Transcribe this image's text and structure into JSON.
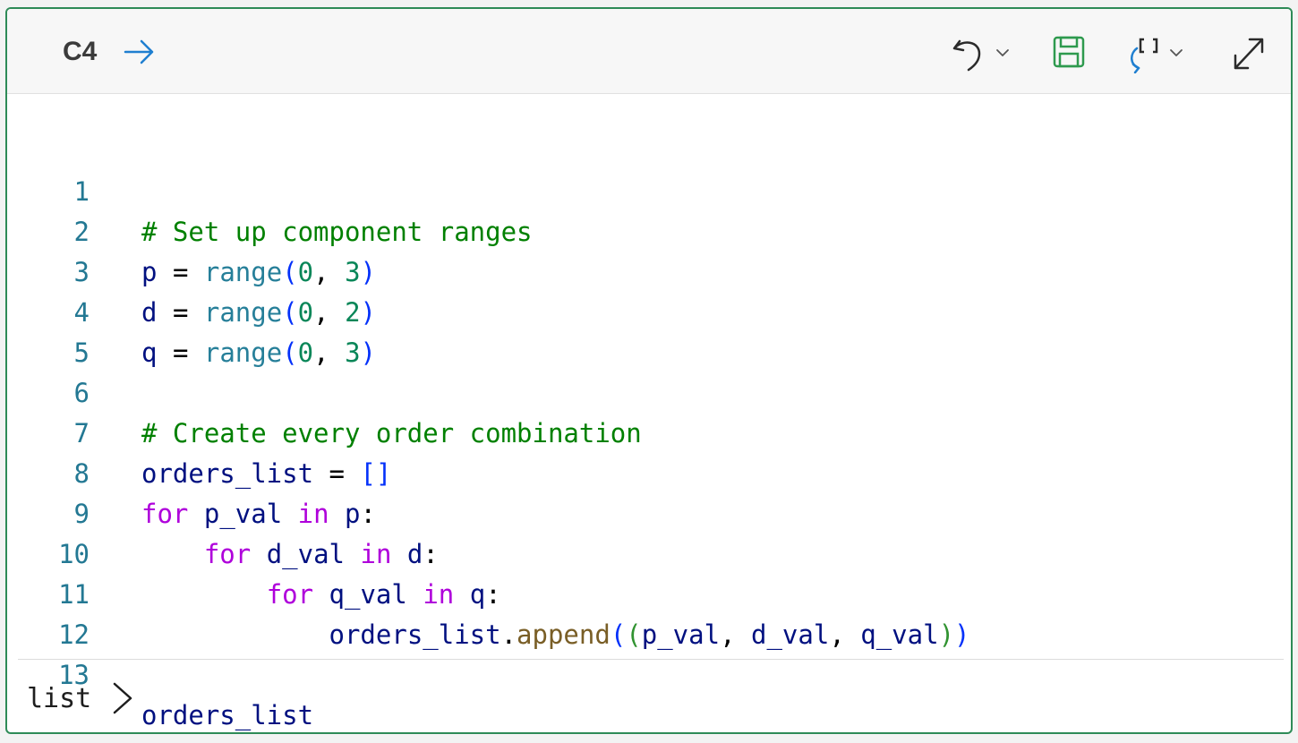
{
  "header": {
    "cell_ref": "C4",
    "arrow_icon": "arrow-right-icon",
    "toolbar": [
      {
        "name": "undo",
        "icon": "undo-icon"
      },
      {
        "name": "save",
        "icon": "save-icon"
      },
      {
        "name": "return-type",
        "icon": "return-list-icon"
      },
      {
        "name": "expand",
        "icon": "expand-icon"
      }
    ]
  },
  "code_lines": [
    {
      "n": "1",
      "text": "# Set up component ranges"
    },
    {
      "n": "2",
      "text": "p = range(0, 3)"
    },
    {
      "n": "3",
      "text": "d = range(0, 2)"
    },
    {
      "n": "4",
      "text": "q = range(0, 3)"
    },
    {
      "n": "5",
      "text": ""
    },
    {
      "n": "6",
      "text": "# Create every order combination"
    },
    {
      "n": "7",
      "text": "orders_list = []"
    },
    {
      "n": "8",
      "text": "for p_val in p:"
    },
    {
      "n": "9",
      "text": "    for d_val in d:"
    },
    {
      "n": "10",
      "text": "        for q_val in q:"
    },
    {
      "n": "11",
      "text": "            orders_list.append((p_val, d_val, q_val))"
    },
    {
      "n": "12",
      "text": ""
    },
    {
      "n": "13",
      "text": "orders_list"
    }
  ],
  "output": {
    "label": "list",
    "icon": "chevron-right-icon"
  },
  "colors": {
    "border": "#2e8b57",
    "line_number": "#237893",
    "comment": "#008000",
    "keyword": "#af00db",
    "function": "#267f99",
    "number": "#098658",
    "variable": "#001080",
    "method": "#795e26"
  }
}
